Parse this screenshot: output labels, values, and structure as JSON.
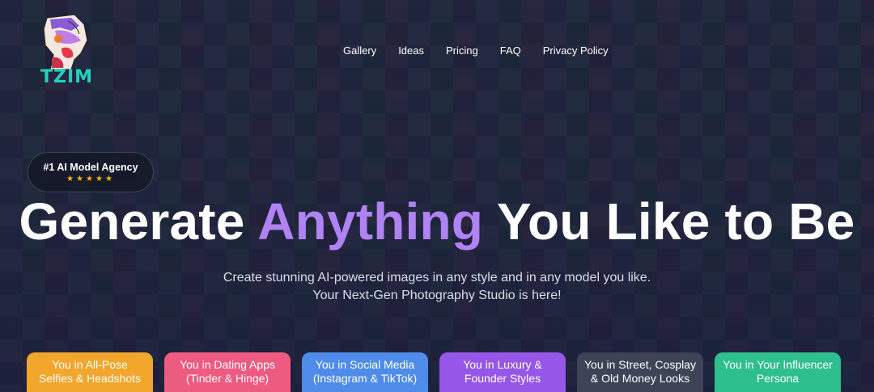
{
  "brand": {
    "logo_text": "TZIM"
  },
  "nav": {
    "items": [
      "Gallery",
      "Ideas",
      "Pricing",
      "FAQ",
      "Privacy Policy"
    ]
  },
  "badge": {
    "title": "#1 AI Model Agency",
    "stars": "★★★★★"
  },
  "hero": {
    "headline_before": "Generate",
    "headline_accent": "Anything",
    "headline_after": "You Like to Be",
    "subtitle_line1": "Create stunning AI-powered images in any style and in any model you like.",
    "subtitle_line2": "Your Next-Gen Photography Studio is here!"
  },
  "cards": [
    {
      "line1": "You in All-Pose",
      "line2": "Selfies & Headshots",
      "color": "#f2a62c"
    },
    {
      "line1": "You in Dating Apps",
      "line2": "(Tinder & Hinge)",
      "color": "#ee5b80"
    },
    {
      "line1": "You in Social Media",
      "line2": "(Instagram & TikTok)",
      "color": "#4f8cea"
    },
    {
      "line1": "You in Luxury &",
      "line2": "Founder Styles",
      "color": "#9657e8"
    },
    {
      "line1": "You in Street, Cosplay",
      "line2": "& Old Money Looks",
      "color": "#3c4456"
    },
    {
      "line1": "You in Your Influencer",
      "line2": "Persona",
      "color": "#2ebf8f"
    }
  ],
  "colors": {
    "accent": "#b083f5",
    "stars": "#f5b400",
    "logo": "#1fd2bf"
  }
}
